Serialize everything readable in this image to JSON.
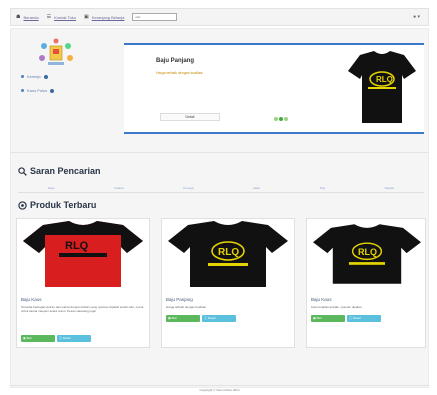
{
  "topbar": {
    "items": [
      {
        "icon": "home-icon",
        "label": "Beranda"
      },
      {
        "icon": "list-icon",
        "label": "Kontak Toko"
      },
      {
        "icon": "cart-icon",
        "label": "Keranjang Belanja"
      }
    ],
    "search_value": "cari",
    "user_icon": "user-icon"
  },
  "sidebar": {
    "items": [
      {
        "label": "Kemeja"
      },
      {
        "label": "Kaos Polos"
      }
    ]
  },
  "slider": {
    "title": "Baju Panjang",
    "description": "Harga terbaik dengan kualitas",
    "button_label": "Detail"
  },
  "search_section": {
    "title": "Saran Pencarian",
    "categories": [
      "Kaos",
      "Celana",
      "Kemeja",
      "Jaket",
      "Topi",
      "Sepatu"
    ]
  },
  "products_section": {
    "title": "Produk Terbaru",
    "items": [
      {
        "name": "Baju Kaos",
        "description": "Tersedia berbagai ukuran dan warna dengan bahan yang nyaman dipakai sehari-hari, cocok untuk santai maupun acara resmi. Pesan sekarang juga!",
        "buy_label": "Beli",
        "detail_label": "Detail",
        "shirt_color": "#d81e1e",
        "sleeve_color": "#111111"
      },
      {
        "name": "Baju Panjang",
        "description": "Harga terbaik dengan kualitas",
        "buy_label": "Beli",
        "detail_label": "Detail",
        "shirt_color": "#111111",
        "sleeve_color": "#111111"
      },
      {
        "name": "Baju Kaos",
        "description": "Kaos kualitas terbaik, nyaman dipakai",
        "buy_label": "Beli",
        "detail_label": "Detail",
        "shirt_color": "#111111",
        "sleeve_color": "#111111"
      }
    ]
  },
  "footer": {
    "text": "Copyright © Toko Online 2014"
  },
  "colors": {
    "accent": "#3a78c8",
    "success": "#5cb85c",
    "info": "#5bc0de",
    "link": "#6b6b9a"
  }
}
